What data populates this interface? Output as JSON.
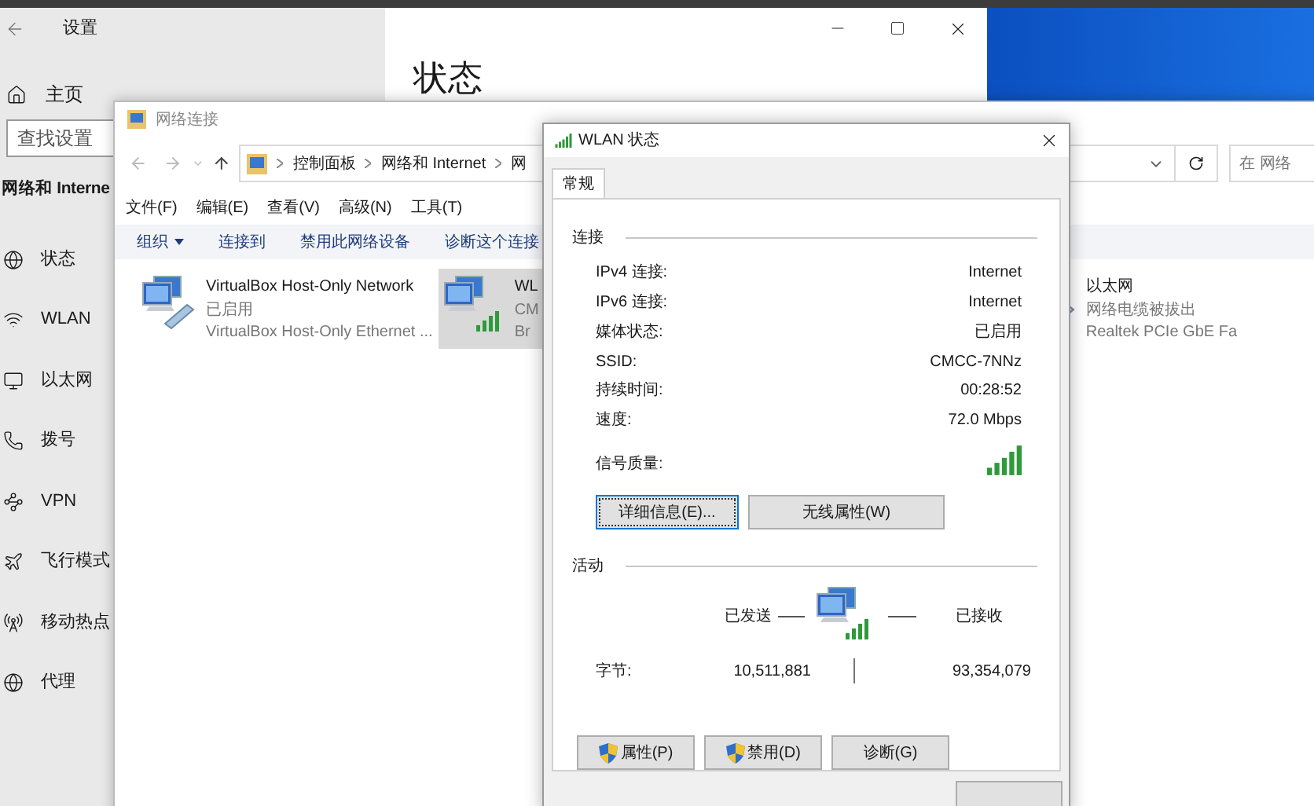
{
  "settings_window": {
    "title": "设置",
    "heading": "状态",
    "home": "主页",
    "search": {
      "placeholder": "查找设置"
    },
    "section": "网络和 Interne",
    "nav_items": [
      {
        "label": "状态"
      },
      {
        "label": "WLAN"
      },
      {
        "label": "以太网"
      },
      {
        "label": "拨号"
      },
      {
        "label": "VPN"
      },
      {
        "label": "飞行模式"
      },
      {
        "label": "移动热点"
      },
      {
        "label": "代理"
      }
    ]
  },
  "network_window": {
    "title": "网络连接",
    "breadcrumb": [
      "控制面板",
      "网络和 Internet",
      "网"
    ],
    "search": {
      "placeholder": "在 网络"
    },
    "menu": [
      "文件(F)",
      "编辑(E)",
      "查看(V)",
      "高级(N)",
      "工具(T)"
    ],
    "toolbar": [
      {
        "label": "组织",
        "dropdown": true
      },
      {
        "label": "连接到",
        "dropdown": false
      },
      {
        "label": "禁用此网络设备",
        "dropdown": false
      },
      {
        "label": "诊断这个连接",
        "dropdown": false
      }
    ],
    "adapters": [
      {
        "kind": "cable",
        "name": "VirtualBox Host-Only Network",
        "status": "已启用",
        "device": "VirtualBox Host-Only Ethernet ...",
        "selected": false
      },
      {
        "kind": "wireless",
        "name": "WL",
        "status": "CM",
        "device": "Br",
        "selected": true
      },
      {
        "kind": "unplugged",
        "name": "以太网",
        "status": "网络电缆被拔出",
        "device": "Realtek PCIe GbE Fa",
        "selected": false
      }
    ]
  },
  "dialog": {
    "title": "WLAN 状态",
    "tabs": [
      {
        "label": "常规",
        "selected": true
      }
    ],
    "connection": {
      "heading": "连接",
      "rows": [
        {
          "label": "IPv4 连接:",
          "value": "Internet"
        },
        {
          "label": "IPv6 连接:",
          "value": "Internet"
        },
        {
          "label": "媒体状态:",
          "value": "已启用"
        },
        {
          "label": "SSID:",
          "value": "CMCC-7NNz"
        },
        {
          "label": "持续时间:",
          "value": "00:28:52"
        },
        {
          "label": "速度:",
          "value": "72.0 Mbps"
        }
      ],
      "signal_label": "信号质量:",
      "buttons": [
        {
          "label": "详细信息(E)...",
          "focused": true
        },
        {
          "label": "无线属性(W)",
          "focused": false
        }
      ]
    },
    "activity": {
      "heading": "活动",
      "sent_label": "已发送",
      "received_label": "已接收",
      "bytes_label": "字节:",
      "bytes_sent": "10,511,881",
      "bytes_received": "93,354,079",
      "buttons": [
        {
          "label": "属性(P)",
          "shield": true
        },
        {
          "label": "禁用(D)",
          "shield": true
        },
        {
          "label": "诊断(G)",
          "shield": false
        }
      ]
    }
  }
}
